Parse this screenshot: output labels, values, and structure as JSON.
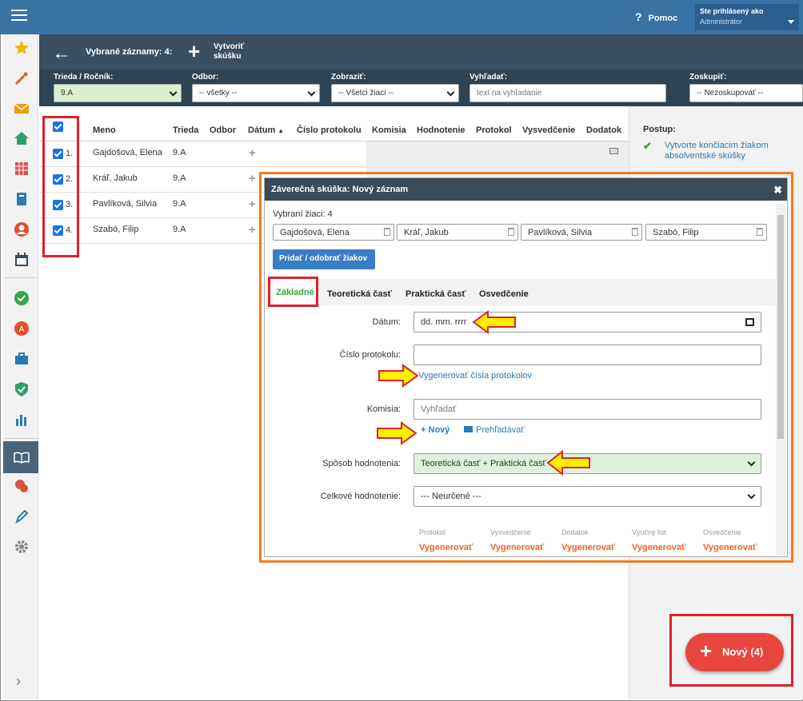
{
  "topbar": {
    "help_label": "Pomoc",
    "user_line1": "Ste prihlásený ako",
    "user_line2": "Administrátor"
  },
  "toolbar": {
    "selected_label": "Vybrané záznamy: 4:",
    "create_label": "Vytvoriť skúšku"
  },
  "filters": {
    "class": {
      "label": "Trieda / Ročník:",
      "value": "9.A"
    },
    "branch": {
      "label": "Odbor:",
      "value": "-- všetky --"
    },
    "show": {
      "label": "Zobraziť:",
      "value": "-- Všetci žiaci --"
    },
    "search": {
      "label": "Vyhľadať:",
      "placeholder": "text na vyhľadanie"
    },
    "group": {
      "label": "Zoskupiť:",
      "value": "-- Nezoskupovať --"
    }
  },
  "table": {
    "headers": [
      "Meno",
      "Trieda",
      "Odbor",
      "Dátum",
      "Číslo protokolu",
      "Komisia",
      "Hodnotenie",
      "Protokol",
      "Vysvedčenie",
      "Dodatok"
    ],
    "rows": [
      {
        "num": "1.",
        "name": "Gajdošová, Elena",
        "class": "9.A"
      },
      {
        "num": "2.",
        "name": "Kráľ, Jakub",
        "class": "9.A"
      },
      {
        "num": "3.",
        "name": "Pavlíková, Silvia",
        "class": "9.A"
      },
      {
        "num": "4.",
        "name": "Szabó, Filip",
        "class": "9.A"
      }
    ]
  },
  "sidepanel": {
    "title": "Postup:",
    "step": "Vytvorte končiacim žiakom absolventské skúšky"
  },
  "modal": {
    "title": "Záverečná skúška: Nový záznam",
    "selected_count": "Vybraní žiaci: 4",
    "students": [
      "Gajdošová, Elena",
      "Kráľ, Jakub",
      "Pavlíková, Silvia",
      "Szabó, Filip"
    ],
    "add_remove_button": "Pridať / odobrať žiakov",
    "tabs": [
      "Základné",
      "Teoretická časť",
      "Praktická časť",
      "Osvedčenie"
    ],
    "form": {
      "date_label": "Dátum:",
      "date_placeholder": "dd. mm. rrrr",
      "protocol_label": "Číslo protokolu:",
      "generate_numbers_link": "Vygenerovať čísla protokolov",
      "commission_label": "Komisia:",
      "commission_placeholder": "Vyhľadať",
      "new_link": "Nový",
      "browse_link": "Prehľadávať",
      "method_label": "Spôsob hodnotenia:",
      "method_value": "Teoretická časť + Praktická časť",
      "overall_label": "Celkové hodnotenie:",
      "overall_value": "--- Neurčené ---"
    },
    "documents": [
      {
        "label": "Protokol",
        "action": "Vygenerovať"
      },
      {
        "label": "Vysvedčenie",
        "action": "Vygenerovať"
      },
      {
        "label": "Dodatok",
        "action": "Vygenerovať"
      },
      {
        "label": "Výučný list",
        "action": "Vygenerovať"
      },
      {
        "label": "Osvedčenie",
        "action": "Vygenerovať"
      }
    ]
  },
  "fab": {
    "label": "Nový (4)"
  },
  "colors": {
    "topbar": "#3b72a4",
    "accent_green": "#3aa34a",
    "fab": "#e8463f",
    "annotation_red": "#e0202c",
    "annotation_orange": "#f47b20"
  }
}
